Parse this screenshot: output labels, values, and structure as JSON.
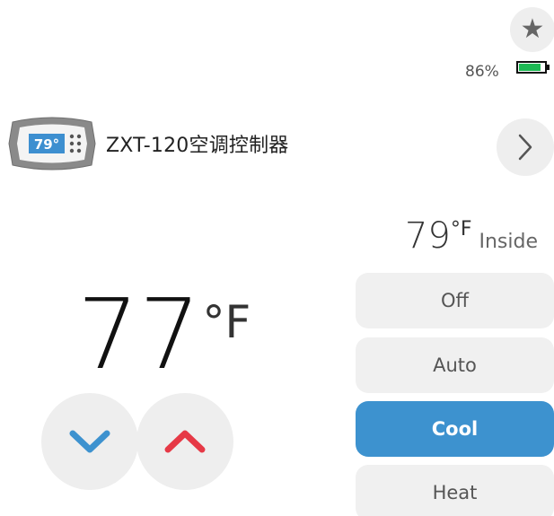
{
  "header": {
    "favorite_icon": "star-icon",
    "battery_percent": "86%",
    "battery_level": 0.86,
    "battery_color": "#1db954"
  },
  "device": {
    "thumbnail_display": "79°",
    "name": "ZXT-120空调控制器",
    "detail_icon": "chevron-right-icon"
  },
  "status": {
    "inside_value": "79",
    "inside_unit": "°F",
    "inside_label": "Inside"
  },
  "setpoint": {
    "value": "77",
    "unit": "°F"
  },
  "controls": {
    "down_icon": "chevron-down-icon",
    "down_color": "#3d92cf",
    "up_icon": "chevron-up-icon",
    "up_color": "#e63946"
  },
  "modes": [
    {
      "label": "Off",
      "active": false
    },
    {
      "label": "Auto",
      "active": false
    },
    {
      "label": "Cool",
      "active": true
    },
    {
      "label": "Heat",
      "active": false
    }
  ],
  "accent_color": "#3d92cf"
}
